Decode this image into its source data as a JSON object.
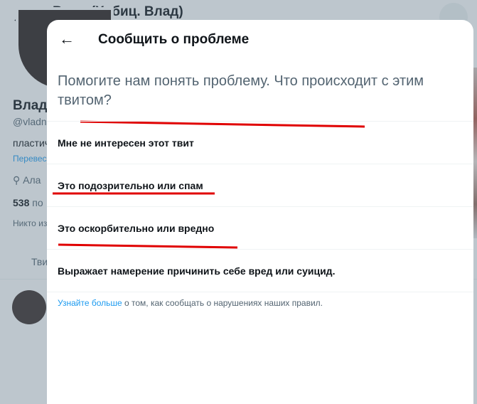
{
  "background": {
    "header_title": "Влад (Хабиц. Влад)",
    "profile_name": "Влад",
    "handle": "@vladn",
    "bio": "пластич",
    "translate": "Перевес",
    "location": "Ала",
    "stats": "538",
    "stats_suffix": "по",
    "nobody": "Никто из",
    "tab": "Тви"
  },
  "modal": {
    "title": "Сообщить о проблеме",
    "question": "Помогите нам понять проблему. Что происходит с этим твитом?",
    "options": [
      {
        "label": "Мне не интересен этот твит"
      },
      {
        "label": "Это подозрительно или спам"
      },
      {
        "label": "Это оскорбительно или вредно"
      },
      {
        "label": "Выражает намерение причинить себе вред или суицид."
      }
    ],
    "footnote_link": "Узнайте больше",
    "footnote_text": " о том, как сообщать о нарушениях наших правил."
  },
  "colors": {
    "accent": "#1d9bf0",
    "annotation_red": "#e00000",
    "overlay": "#5b7083"
  },
  "icons": {
    "back": "arrow-left-icon",
    "search": "search-icon"
  }
}
